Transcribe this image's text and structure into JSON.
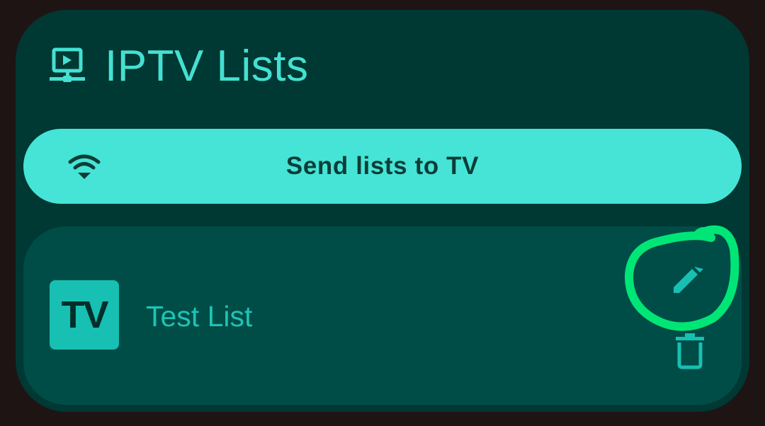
{
  "dialog": {
    "title": "IPTV Lists",
    "title_icon": "network-monitor-icon"
  },
  "send_button": {
    "label": "Send lists to TV",
    "icon": "wifi-icon"
  },
  "lists": [
    {
      "logo_text": "TV",
      "name": "Test List",
      "edit_icon": "pencil-icon",
      "delete_icon": "trash-icon"
    }
  ],
  "colors": {
    "background": "#1e1414",
    "dialog_bg": "#003833",
    "accent": "#45e4d6",
    "card_bg": "#004d47",
    "list_text": "#1ec3b5",
    "highlight": "#00e676"
  }
}
